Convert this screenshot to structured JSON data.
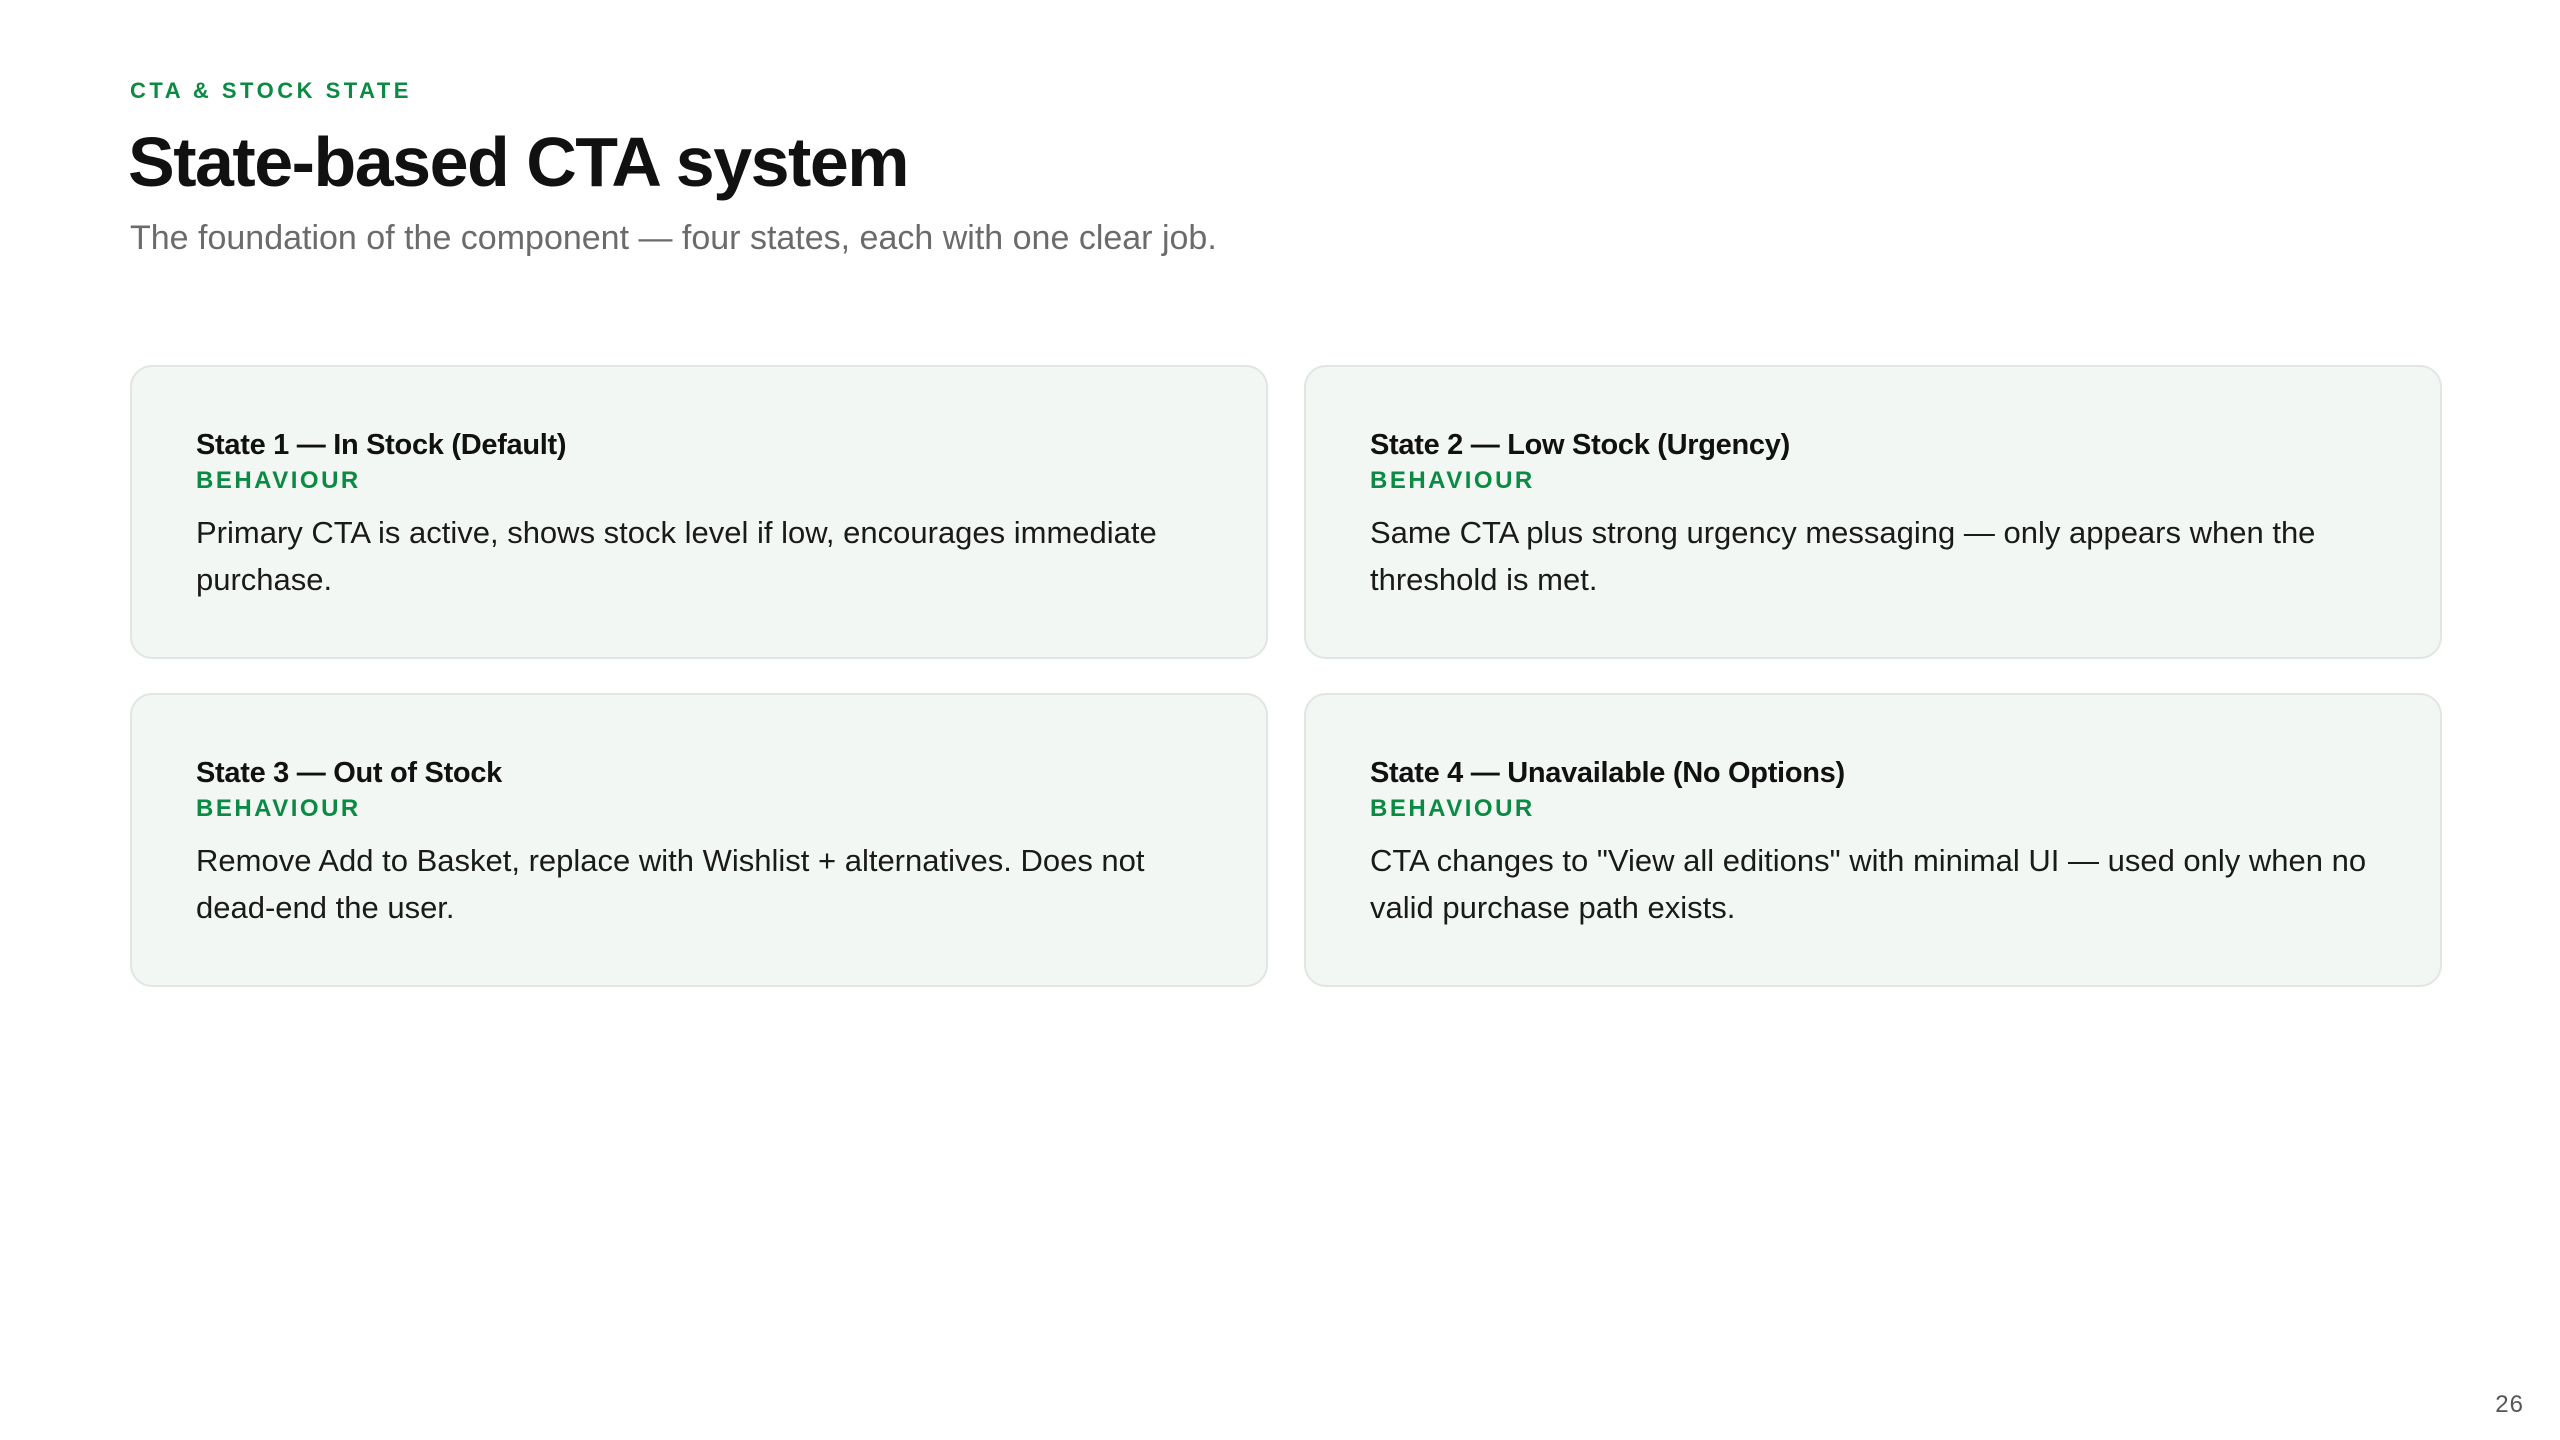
{
  "header": {
    "eyebrow": "CTA & STOCK STATE",
    "title": "State-based CTA system",
    "subtitle": "The foundation of the component — four states, each with one clear job."
  },
  "cards": [
    {
      "title": "State 1 — In Stock (Default)",
      "tag": "BEHAVIOUR",
      "body": "Primary CTA is active, shows stock level if low, encourages immediate purchase."
    },
    {
      "title": "State 2 — Low Stock (Urgency)",
      "tag": "BEHAVIOUR",
      "body": "Same CTA plus strong urgency messaging — only appears when the threshold is met."
    },
    {
      "title": "State 3 — Out of Stock",
      "tag": "BEHAVIOUR",
      "body": "Remove Add to Basket, replace with Wishlist + alternatives. Does not dead-end the user."
    },
    {
      "title": "State 4 — Unavailable (No Options)",
      "tag": "BEHAVIOUR",
      "body": "CTA changes to \"View all editions\" with minimal UI — used only when no valid purchase path exists."
    }
  ],
  "footer": {
    "page_number": "26"
  },
  "colors": {
    "accent": "#0a8a43",
    "card_background": "#f3f7f4",
    "card_border": "#e0e6e2",
    "subtitle": "#6b6b6b"
  }
}
